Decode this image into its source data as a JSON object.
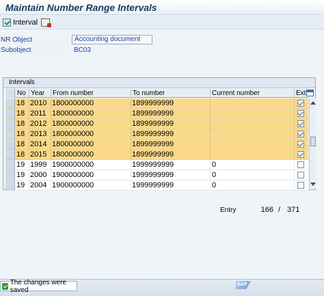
{
  "title": "Maintain Number Range Intervals",
  "toolbar": {
    "interval_label": "Interval"
  },
  "header": {
    "nr_object_label": "NR Object",
    "nr_object_value": "Accounting document",
    "subobject_label": "Subobject",
    "subobject_value": "BC03"
  },
  "intervals": {
    "panel_title": "Intervals",
    "columns": [
      "No",
      "Year",
      "From number",
      "To number",
      "Current number",
      "Ext"
    ],
    "rows": [
      {
        "no": "18",
        "year": "2010",
        "from": "1800000000",
        "to": "1899999999",
        "current": "",
        "ext": true,
        "highlighted": true
      },
      {
        "no": "18",
        "year": "2011",
        "from": "1800000000",
        "to": "1899999999",
        "current": "",
        "ext": true,
        "highlighted": true
      },
      {
        "no": "18",
        "year": "2012",
        "from": "1800000000",
        "to": "1899999999",
        "current": "",
        "ext": true,
        "highlighted": true
      },
      {
        "no": "18",
        "year": "2013",
        "from": "1800000000",
        "to": "1899999999",
        "current": "",
        "ext": true,
        "highlighted": true
      },
      {
        "no": "18",
        "year": "2014",
        "from": "1800000000",
        "to": "1899999999",
        "current": "",
        "ext": true,
        "highlighted": true
      },
      {
        "no": "18",
        "year": "2015",
        "from": "1800000000",
        "to": "1899999999",
        "current": "",
        "ext": true,
        "highlighted": true
      },
      {
        "no": "19",
        "year": "1999",
        "from": "1900000000",
        "to": "1999999999",
        "current": "0",
        "ext": false,
        "highlighted": false
      },
      {
        "no": "19",
        "year": "2000",
        "from": "1900000000",
        "to": "1999999999",
        "current": "0",
        "ext": false,
        "highlighted": false
      },
      {
        "no": "19",
        "year": "2004",
        "from": "1900000000",
        "to": "1999999999",
        "current": "0",
        "ext": false,
        "highlighted": false
      }
    ]
  },
  "entry": {
    "label": "Entry",
    "current": "166",
    "separator": "/",
    "total": "371"
  },
  "status": {
    "message": "The changes were saved",
    "logo_text": "SAP"
  },
  "colors": {
    "highlight_row": "#fbd98a",
    "label_blue": "#1f3fa0",
    "ok_green": "#2e9b2e"
  }
}
